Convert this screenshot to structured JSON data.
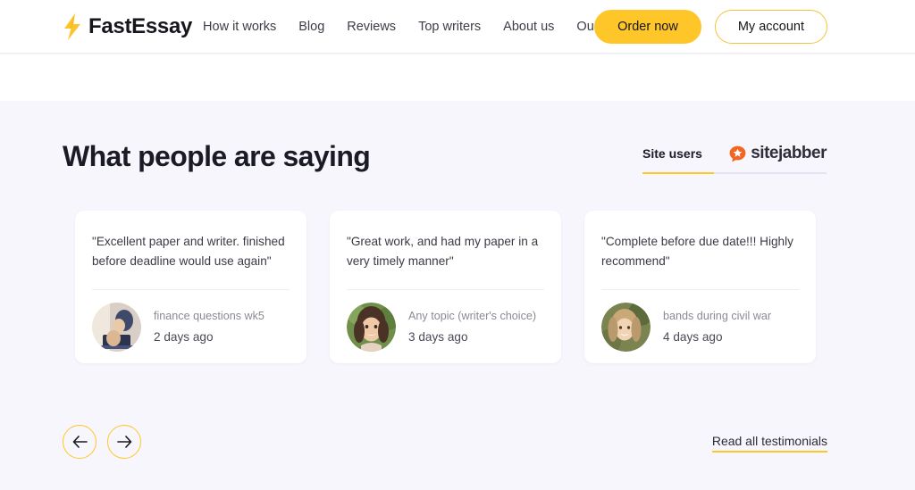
{
  "header": {
    "brand_name": "FastEssay",
    "logo_icon": "lightning-bolt-icon",
    "nav": [
      {
        "label": "How it works"
      },
      {
        "label": "Blog"
      },
      {
        "label": "Reviews"
      },
      {
        "label": "Top writers"
      },
      {
        "label": "About us"
      },
      {
        "label": "Our service"
      }
    ],
    "order_button": "Order now",
    "account_button": "My account"
  },
  "section": {
    "title": "What people are saying",
    "tabs": {
      "site_users": "Site users",
      "sitejabber": "sitejabber",
      "sitejabber_icon": "sitejabber-star-bubble-icon",
      "active": "Site users"
    },
    "cards": [
      {
        "quote": "\"Excellent paper and writer. finished before deadline would use again\"",
        "topic": "finance questions wk5",
        "time": "2 days ago",
        "avatar": "avatar-person-at-laptop"
      },
      {
        "quote": "\"Great work, and had my paper in a very timely manner\"",
        "topic": "Any topic (writer's choice)",
        "time": "3 days ago",
        "avatar": "avatar-smiling-woman"
      },
      {
        "quote": "\"Complete before due date!!! Highly recommend\"",
        "topic": "bands during civil war",
        "time": "4 days ago",
        "avatar": "avatar-woman-outdoors"
      }
    ],
    "prev_label": "←",
    "next_label": "→",
    "read_all_link": "Read all testimonials"
  },
  "colors": {
    "accent_yellow": "#ffc629",
    "sitejabber_orange": "#f26522",
    "section_background": "#f8f6fd",
    "card_background": "#ffffff",
    "text_dark": "#1b1b26"
  }
}
